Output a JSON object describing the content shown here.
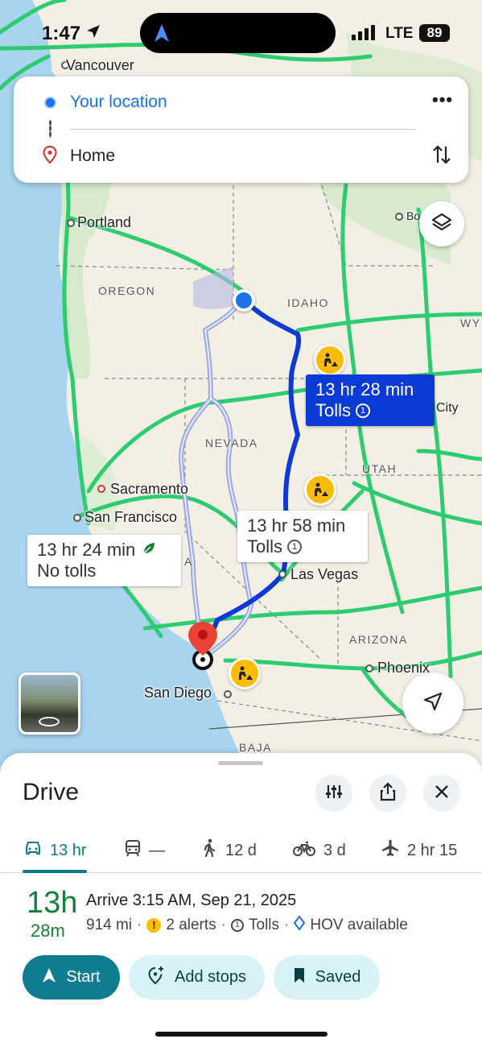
{
  "status_bar": {
    "time": "1:47",
    "network": "LTE",
    "battery": "89"
  },
  "route_card": {
    "origin": "Your location",
    "destination": "Home",
    "more_label": "•••"
  },
  "map": {
    "cities": {
      "vancouver": "Vancouver",
      "portland": "Portland",
      "sacramento": "Sacramento",
      "san_francisco": "San Francisco",
      "las_vegas": "Las Vegas",
      "phoenix": "Phoenix",
      "san_diego": "San Diego",
      "boise": "Bo",
      "city_partial": "City"
    },
    "states": {
      "oregon": "OREGON",
      "idaho": "IDAHO",
      "nevada": "NEVADA",
      "utah": "UTAH",
      "arizona": "ARIZONA",
      "baja": "BAJA",
      "wy": "WY",
      "a": "A"
    },
    "callouts": {
      "primary": {
        "time": "13 hr 28 min",
        "note": "Tolls"
      },
      "alt1": {
        "time": "13 hr 58 min",
        "note": "Tolls"
      },
      "alt2": {
        "time": "13 hr 24 min",
        "note": "No tolls"
      }
    },
    "colors": {
      "primary_route": "#0b3bd4",
      "alt_route": "#9aa8e8",
      "highway": "#2ecc71",
      "water": "#a8d4f0"
    }
  },
  "sheet": {
    "title": "Drive",
    "modes": [
      {
        "icon": "car-icon",
        "label": "13 hr"
      },
      {
        "icon": "transit-icon",
        "label": "—"
      },
      {
        "icon": "walk-icon",
        "label": "12 d"
      },
      {
        "icon": "bike-icon",
        "label": "3 d"
      },
      {
        "icon": "flight-icon",
        "label": "2 hr 15"
      }
    ],
    "duration_hours": "13h",
    "duration_minutes": "28m",
    "arrive": "Arrive 3:15 AM, Sep 21, 2025",
    "distance": "914 mi",
    "alerts": "2 alerts",
    "tolls": "Tolls",
    "hov": "HOV available",
    "sep": "·",
    "buttons": {
      "start": "Start",
      "add_stops": "Add stops",
      "saved": "Saved"
    }
  }
}
